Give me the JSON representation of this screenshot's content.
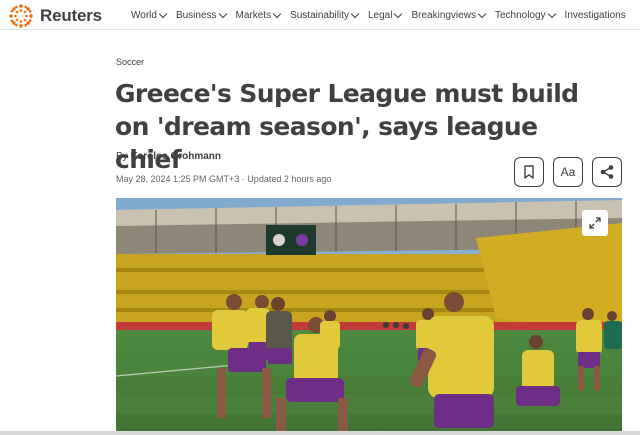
{
  "brand": {
    "name": "Reuters",
    "accent": "#fa6400"
  },
  "nav": [
    {
      "label": "World",
      "has_menu": true
    },
    {
      "label": "Business",
      "has_menu": true
    },
    {
      "label": "Markets",
      "has_menu": true
    },
    {
      "label": "Sustainability",
      "has_menu": true
    },
    {
      "label": "Legal",
      "has_menu": true
    },
    {
      "label": "Breakingviews",
      "has_menu": true
    },
    {
      "label": "Technology",
      "has_menu": true
    },
    {
      "label": "Investigations",
      "has_menu": false
    }
  ],
  "article": {
    "section": "Soccer",
    "headline": "Greece's Super League must build on 'dream season', says league chief",
    "byline_prefix": "By",
    "author": "Karolos Grohmann",
    "dateline": "May 28, 2024 1:25 PM GMT+3 · Updated 2 hours ago",
    "tools": {
      "bookmark_icon": "bookmark-icon",
      "font_label": "Aa",
      "share_icon": "share-icon"
    },
    "photo": {
      "expand_icon": "expand-icon"
    }
  }
}
